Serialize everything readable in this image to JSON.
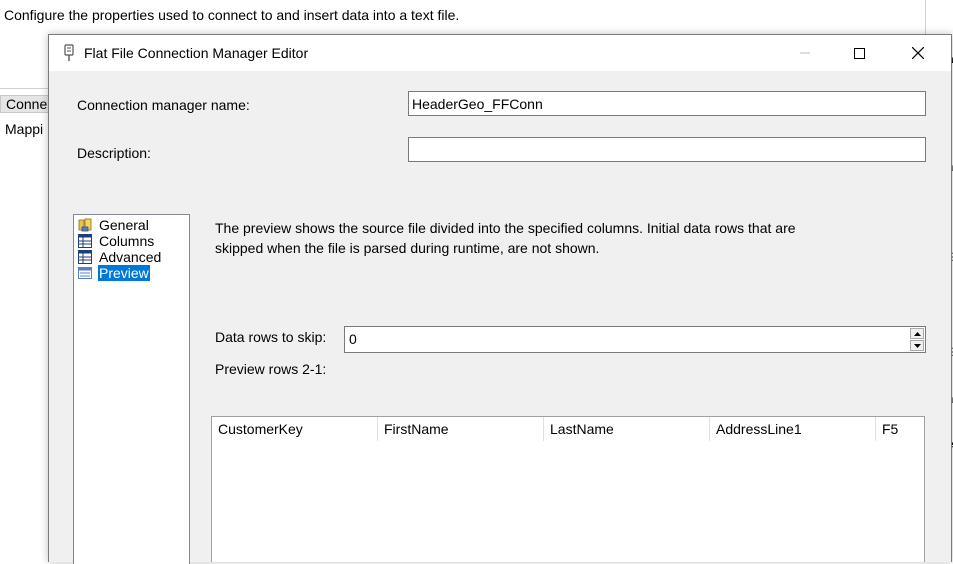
{
  "background": {
    "description": "Configure the properties used to connect to and insert data into a text file.",
    "left_items": [
      "Conne",
      "Mappi"
    ]
  },
  "dialog": {
    "title": "Flat File Connection Manager Editor",
    "connection_name_label": "Connection manager name:",
    "connection_name_value": "HeaderGeo_FFConn",
    "description_label": "Description:",
    "description_value": ""
  },
  "nav": {
    "items": [
      {
        "label": "General",
        "icon": "general-icon"
      },
      {
        "label": "Columns",
        "icon": "columns-icon"
      },
      {
        "label": "Advanced",
        "icon": "advanced-icon"
      },
      {
        "label": "Preview",
        "icon": "preview-icon",
        "selected": true
      }
    ]
  },
  "preview": {
    "info": "The preview shows the source file divided into the specified columns. Initial data rows that are skipped when the file is parsed during runtime, are not shown.",
    "skip_label": "Data rows to skip:",
    "skip_value": "0",
    "rows_label": "Preview rows 2-1:",
    "columns": [
      "CustomerKey",
      "FirstName",
      "LastName",
      "AddressLine1",
      "F5"
    ]
  },
  "colors": {
    "selection": "#0078d7",
    "dialog_bg": "#f0f0f0"
  }
}
